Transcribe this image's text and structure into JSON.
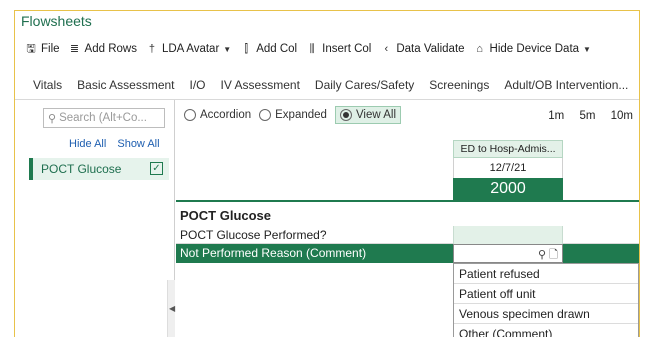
{
  "app": {
    "title": "Flowsheets"
  },
  "toolbar": {
    "items": [
      {
        "icon": "save-icon",
        "label": "File"
      },
      {
        "icon": "add-rows-icon",
        "label": "Add Rows"
      },
      {
        "icon": "lda-avatar-icon",
        "label": "LDA Avatar"
      },
      {
        "icon": "add-col-icon",
        "label": "Add Col"
      },
      {
        "icon": "insert-col-icon",
        "label": "Insert Col"
      },
      {
        "icon": "data-validate-icon",
        "label": "Data Validate"
      },
      {
        "icon": "hide-device-data-icon",
        "label": "Hide Device Data"
      }
    ]
  },
  "tabs": [
    "Vitals",
    "Basic Assessment",
    "I/O",
    "IV Assessment",
    "Daily Cares/Safety",
    "Screenings",
    "Adult/OB Intervention..."
  ],
  "sidebar": {
    "search_placeholder": "Search (Alt+Co...",
    "hide_all": "Hide All",
    "show_all": "Show All",
    "selected_item": "POCT Glucose"
  },
  "view": {
    "options": [
      "Accordion",
      "Expanded",
      "View All"
    ],
    "selected": "View All",
    "zoom": [
      "1m",
      "5m",
      "10m"
    ]
  },
  "column": {
    "encounter": "ED to Hosp-Admis...",
    "date": "12/7/21",
    "time": "2000"
  },
  "section": {
    "title": "POCT Glucose",
    "rows": [
      "POCT Glucose Performed?",
      "Not Performed Reason (Comment)"
    ]
  },
  "dropdown": {
    "options": [
      "Patient refused",
      "Patient off unit",
      "Venous specimen drawn",
      "Other (Comment)"
    ]
  },
  "colors": {
    "accent": "#1f7a4f",
    "highlight": "#e3f1e8",
    "frame": "#e8c24a"
  }
}
